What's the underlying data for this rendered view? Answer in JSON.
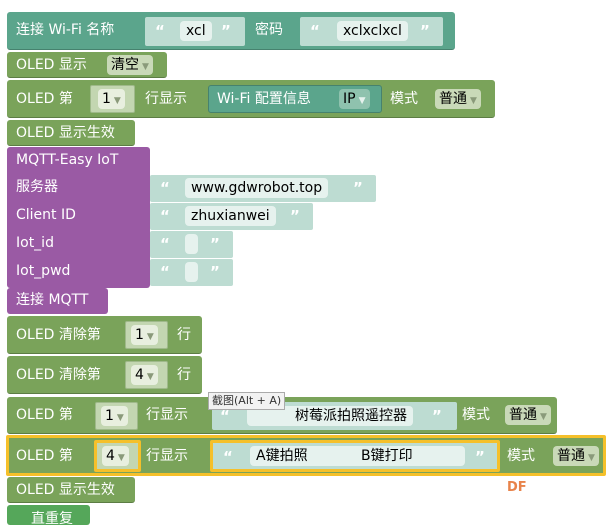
{
  "wifi": {
    "label": "连接 Wi-Fi 名称",
    "ssid": "xcl",
    "pwd_label": "密码",
    "pwd": "xclxclxcl"
  },
  "oled_clear": {
    "label": "OLED 显示",
    "option": "清空"
  },
  "oled_line1": {
    "label": "OLED 第",
    "line": "1",
    "show": "行显示",
    "info": "Wi-Fi 配置信息",
    "info_opt": "IP",
    "mode": "模式",
    "mode_opt": "普通"
  },
  "oled_apply1": {
    "label": "OLED 显示生效"
  },
  "mqtt": {
    "title": "MQTT-Easy IoT",
    "server_label": "服务器",
    "server": "www.gdwrobot.top",
    "client_label": "Client ID",
    "client": "zhuxianwei",
    "iot_id_label": "Iot_id",
    "iot_id": "",
    "iot_pwd_label": "Iot_pwd",
    "iot_pwd": ""
  },
  "mqtt_connect": {
    "label": "连接 MQTT"
  },
  "clear_rows": [
    {
      "label": "OLED 清除第",
      "line": "1",
      "suffix": "行"
    },
    {
      "label": "OLED 清除第",
      "line": "4",
      "suffix": "行"
    }
  ],
  "oled_line2": {
    "label": "OLED 第",
    "line": "1",
    "show": "行显示",
    "text": "树莓派拍照遥控器",
    "mode": "模式",
    "mode_opt": "普通"
  },
  "tooltip": "截图(Alt + A)",
  "oled_line3": {
    "label": "OLED 第",
    "line": "4",
    "show": "行显示",
    "text": "A键拍照            B键打印",
    "mode": "模式",
    "mode_opt": "普通"
  },
  "oled_apply2": {
    "label": "OLED 显示生效"
  },
  "loop": {
    "label": "直重复"
  },
  "watermark": "DF",
  "quote_open": "“",
  "quote_close": "”",
  "colors": {
    "oled": "#7aa35a",
    "wifi": "#5ba58c",
    "mqtt": "#9a5aa4",
    "string": "#bddcd2",
    "highlight": "#f5c02a"
  }
}
